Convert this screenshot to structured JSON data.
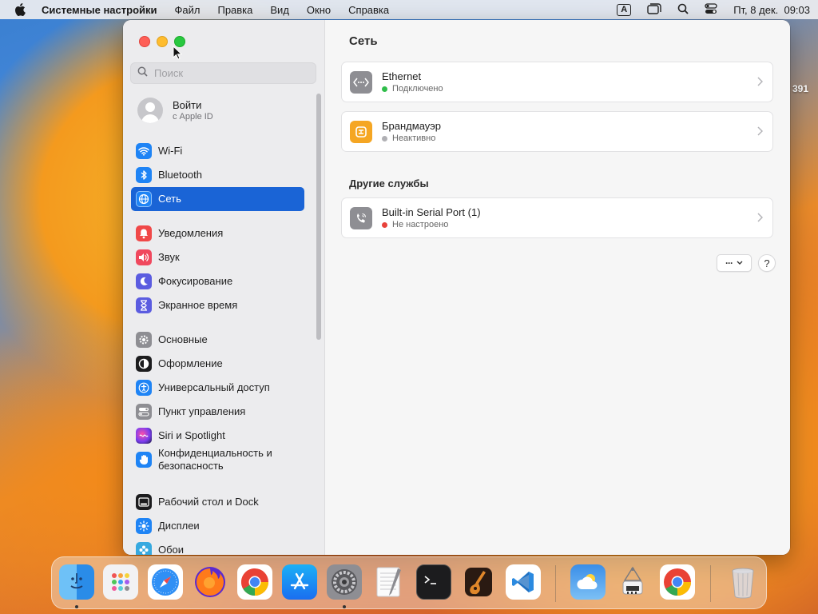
{
  "menubar": {
    "app_name": "Системные настройки",
    "items": [
      "Файл",
      "Правка",
      "Вид",
      "Окно",
      "Справка"
    ],
    "input_indicator": "A",
    "clock": "Пт, 8 дек.  09:03"
  },
  "sidebar": {
    "search_placeholder": "Поиск",
    "account": {
      "title": "Войти",
      "subtitle": "с Apple ID"
    },
    "items": [
      {
        "label": "Wi-Fi",
        "icon": "wifi-icon",
        "color": "#1f84f5"
      },
      {
        "label": "Bluetooth",
        "icon": "bluetooth-icon",
        "color": "#1f84f5"
      },
      {
        "label": "Сеть",
        "icon": "globe-icon",
        "color": "#1f84f5",
        "active": true
      },
      {
        "label": "Уведомления",
        "icon": "bell-icon",
        "color": "#f04848"
      },
      {
        "label": "Звук",
        "icon": "speaker-icon",
        "color": "#f0485e"
      },
      {
        "label": "Фокусирование",
        "icon": "moon-icon",
        "color": "#5b5ce0"
      },
      {
        "label": "Экранное время",
        "icon": "hourglass-icon",
        "color": "#5b5ce0"
      },
      {
        "label": "Основные",
        "icon": "gear-icon",
        "color": "#8e8e93"
      },
      {
        "label": "Оформление",
        "icon": "appearance-icon",
        "color": "#1c1c1e"
      },
      {
        "label": "Универсальный доступ",
        "icon": "accessibility-icon",
        "color": "#1f84f5"
      },
      {
        "label": "Пункт управления",
        "icon": "control-center-icon",
        "color": "#8e8e93"
      },
      {
        "label": "Siri и Spotlight",
        "icon": "siri-icon",
        "color": "#a040d0"
      },
      {
        "label": "Конфиденциальность и безопасность",
        "label_line1": "Конфиденциальность и",
        "label_line2": "безопасность",
        "icon": "hand-icon",
        "color": "#1f84f5"
      },
      {
        "label": "Рабочий стол и Dock",
        "icon": "desktop-dock-icon",
        "color": "#1c1c1e"
      },
      {
        "label": "Дисплеи",
        "icon": "sun-icon",
        "color": "#1f84f5"
      },
      {
        "label": "Обои",
        "icon": "wallpaper-icon",
        "color": "#36a9e0"
      }
    ]
  },
  "content": {
    "title": "Сеть",
    "services": [
      {
        "name": "Ethernet",
        "status": "Подключено",
        "status_color": "#2fbd4a",
        "icon": "ethernet-icon"
      },
      {
        "name": "Брандмауэр",
        "status": "Неактивно",
        "status_color": "#b0b0b4",
        "icon": "firewall-icon"
      }
    ],
    "other_title": "Другие службы",
    "other_services": [
      {
        "name": "Built-in Serial Port (1)",
        "status": "Не настроено",
        "status_color": "#e8423b",
        "icon": "phone-icon"
      }
    ],
    "more_button": "···",
    "help_button": "?"
  },
  "desktop": {
    "edge_label": "391"
  },
  "dock": {
    "apps": [
      "Finder",
      "Launchpad",
      "Safari",
      "Firefox",
      "Chrome",
      "App Store",
      "Системные настройки",
      "TextEdit",
      "Terminal",
      "GarageBand",
      "VS Code",
      "Погода",
      "Расширения",
      "Chrome",
      "Корзина"
    ]
  }
}
